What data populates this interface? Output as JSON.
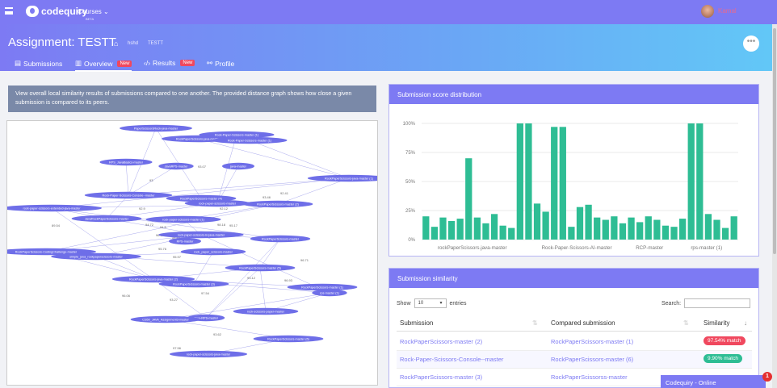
{
  "topbar": {
    "brand": "codequiry",
    "brand_sub": "BETA",
    "courses": "Courses",
    "user_name": "Kamal"
  },
  "header": {
    "title": "Assignment: TESTT",
    "crumbs": [
      "hshd",
      "TESTT"
    ],
    "more_icon": "ellipsis-icon",
    "tabs": [
      {
        "label": "Submissions",
        "icon": "file-icon"
      },
      {
        "label": "Overview",
        "icon": "chart-icon",
        "badge": "New",
        "active": true
      },
      {
        "label": "Results",
        "icon": "code-icon",
        "badge": "New"
      },
      {
        "label": "Profile",
        "icon": "share-icon"
      }
    ]
  },
  "info": "View overall local similarity results of submissions compared to one another. The provided distance graph shows how close a given submission is compared to its peers.",
  "graph": {
    "nodes": [
      "PaperScissorsRock-java-master",
      "RockPaperScissors-java-master",
      "Rock-Paper-Scissors-master (1)",
      "Rock-Paper-Scissors-master (1)",
      "RPS_JavaBasics-master",
      "JavaRPS-master",
      "java-master",
      "RockPaperScissors-java-master (1)",
      "Rock-Paper-Scissors-Console--master",
      "RockPaperScissors-master (4)",
      "rock-paper-scissors-master",
      "RockPaperScissors-master (2)",
      "rock-paper-scissors-extended-java-master",
      "JavaRockPaperScissors-master",
      "rock-paper-scissors-master (1)",
      "rock-paper-scissors-in-java-master",
      "RPS-master",
      "RockPaperScissors-master",
      "RockPaperScissors-CodingChallenge-master",
      "simple_java_rockpaperscissors-master",
      "rock_paper_scissors-master",
      "RockPaperScissors-master (5)",
      "RockPaperScissors-java-master (2)",
      "RockPaperScissors-master (3)",
      "RockPaperScissors-master (1)",
      "rps-master (1)",
      "Java-RPS-master",
      "rock-scissors-paper-master",
      "CS50_JAVA_Assignment3-master",
      "RockPaperScissors-master (6)",
      "rock-paper-scissors-java-master"
    ],
    "edge_labels": [
      "93.07",
      "93",
      "93.46",
      "92.41",
      "92.9",
      "92.12",
      "94.72",
      "94.5",
      "95.17",
      "89.54",
      "96.13",
      "95.97",
      "95.76",
      "97.54",
      "96.06",
      "93.12",
      "96.71",
      "96.93",
      "93.27",
      "93.62",
      "97.56",
      "98.18",
      "94.05",
      "95.55",
      "96.16"
    ]
  },
  "chart_data": {
    "type": "bar",
    "title": "Submission score distribution",
    "categories": [
      "rockPaperScissors.java-master",
      "Rock-Paper-Scissors-AI-master",
      "RCP-master",
      "rps-master (1)"
    ],
    "values": [
      20,
      11,
      19,
      16,
      18,
      70,
      19,
      14,
      22,
      12,
      10,
      100,
      100,
      31,
      24,
      97,
      97,
      11,
      28,
      30,
      19,
      17,
      20,
      14,
      19,
      15,
      20,
      17,
      12,
      11,
      18,
      100,
      100,
      22,
      17,
      10,
      20
    ],
    "yticks": [
      "0%",
      "25%",
      "50%",
      "75%",
      "100%"
    ],
    "ylim": [
      0,
      100
    ],
    "color": "#2ebd94",
    "grid": true
  },
  "similarity": {
    "title": "Submission similarity",
    "show": "Show",
    "entries_value": "10",
    "entries": "entries",
    "search": "Search:",
    "columns": [
      "Submission",
      "Compared submission",
      "Similarity"
    ],
    "rows": [
      {
        "a": "RockPaperScissors-master (2)",
        "b": "RockPaperScissors-master (1)",
        "m": "97.54% match",
        "c": "#f0485e"
      },
      {
        "a": "Rock-Paper-Scissors-Console--master",
        "b": "RockPaperScissors-master (6)",
        "m": "9.90% match",
        "c": "#2ebd94"
      },
      {
        "a": "RockPaperScissors-master (3)",
        "b": "RockPaperScissorss-master",
        "m": "",
        "c": ""
      }
    ]
  },
  "chat": {
    "label": "Codequiry - Online",
    "count": "1"
  }
}
